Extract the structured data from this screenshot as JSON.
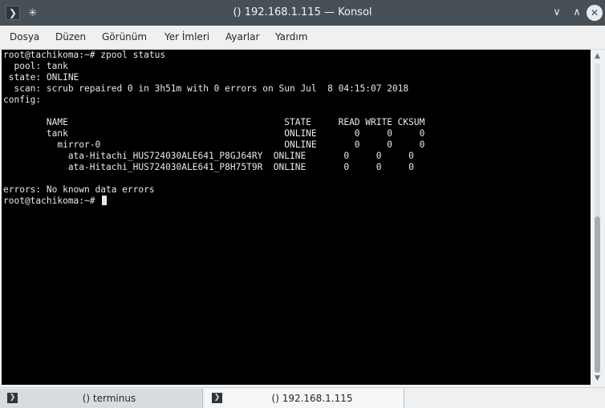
{
  "window": {
    "title": "() 192.168.1.115 — Konsol",
    "app_icon": "terminal-icon",
    "pin_icon": "pin-icon",
    "buttons": {
      "minimize": "∨",
      "maximize": "∧",
      "close": "✕"
    }
  },
  "menu": {
    "items": [
      "Dosya",
      "Düzen",
      "Görünüm",
      "Yer İmleri",
      "Ayarlar",
      "Yardım"
    ]
  },
  "terminal": {
    "lines": [
      "root@tachikoma:~# zpool status",
      "  pool: tank",
      " state: ONLINE",
      "  scan: scrub repaired 0 in 3h51m with 0 errors on Sun Jul  8 04:15:07 2018",
      "config:",
      "",
      "        NAME                                        STATE     READ WRITE CKSUM",
      "        tank                                        ONLINE       0     0     0",
      "          mirror-0                                  ONLINE       0     0     0",
      "            ata-Hitachi_HUS724030ALE641_P8GJ64RY  ONLINE       0     0     0",
      "            ata-Hitachi_HUS724030ALE641_P8H75T9R  ONLINE       0     0     0",
      "",
      "errors: No known data errors",
      "root@tachikoma:~# "
    ]
  },
  "tabs": [
    {
      "label": "() terminus",
      "active": false
    },
    {
      "label": "() 192.168.1.115",
      "active": true
    }
  ],
  "colors": {
    "titlebar": "#475057",
    "terminal_bg": "#000000",
    "terminal_fg": "#e8e8e8"
  }
}
